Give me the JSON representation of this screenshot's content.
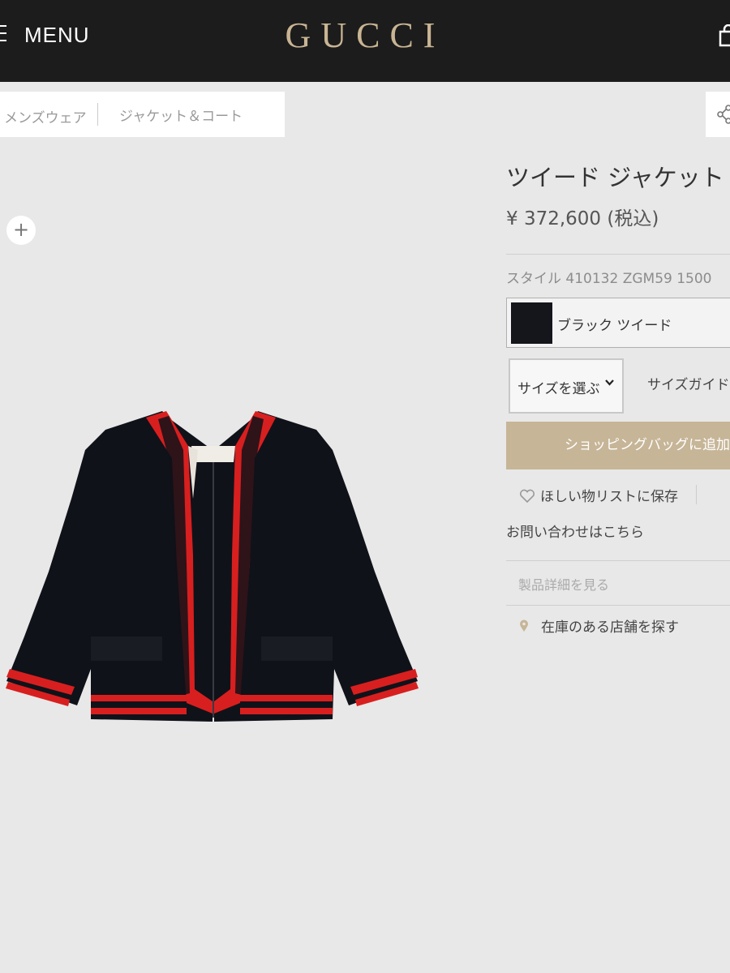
{
  "header": {
    "menu_label": "MENU",
    "logo": "GUCCI",
    "menu_icon": "hamburger-icon",
    "bag_icon": "shopping-bag-icon",
    "background": "#1c1c1c",
    "logo_color": "#c9b593"
  },
  "breadcrumb": {
    "items": [
      "メンズウェア",
      "ジャケット＆コート"
    ]
  },
  "share_icon": "share-icon",
  "zoom_icon": "plus-icon",
  "product": {
    "title": "ツイード ジャケット",
    "price": "¥ 372,600 (税込)",
    "style_code": "スタイル 410132 ZGM59 1500",
    "color_name": "ブラック ツイード",
    "swatch_color": "#15161c",
    "size_select": "サイズを選ぶ",
    "size_guide": "サイズガイド",
    "add_to_bag": "ショッピングバッグに追加",
    "add_to_bag_color": "#c6b597",
    "wishlist": "ほしい物リストに保存",
    "contact": "お問い合わせはこちら",
    "details": "製品詳細を見る",
    "find_store": "在庫のある店舗を探す"
  }
}
